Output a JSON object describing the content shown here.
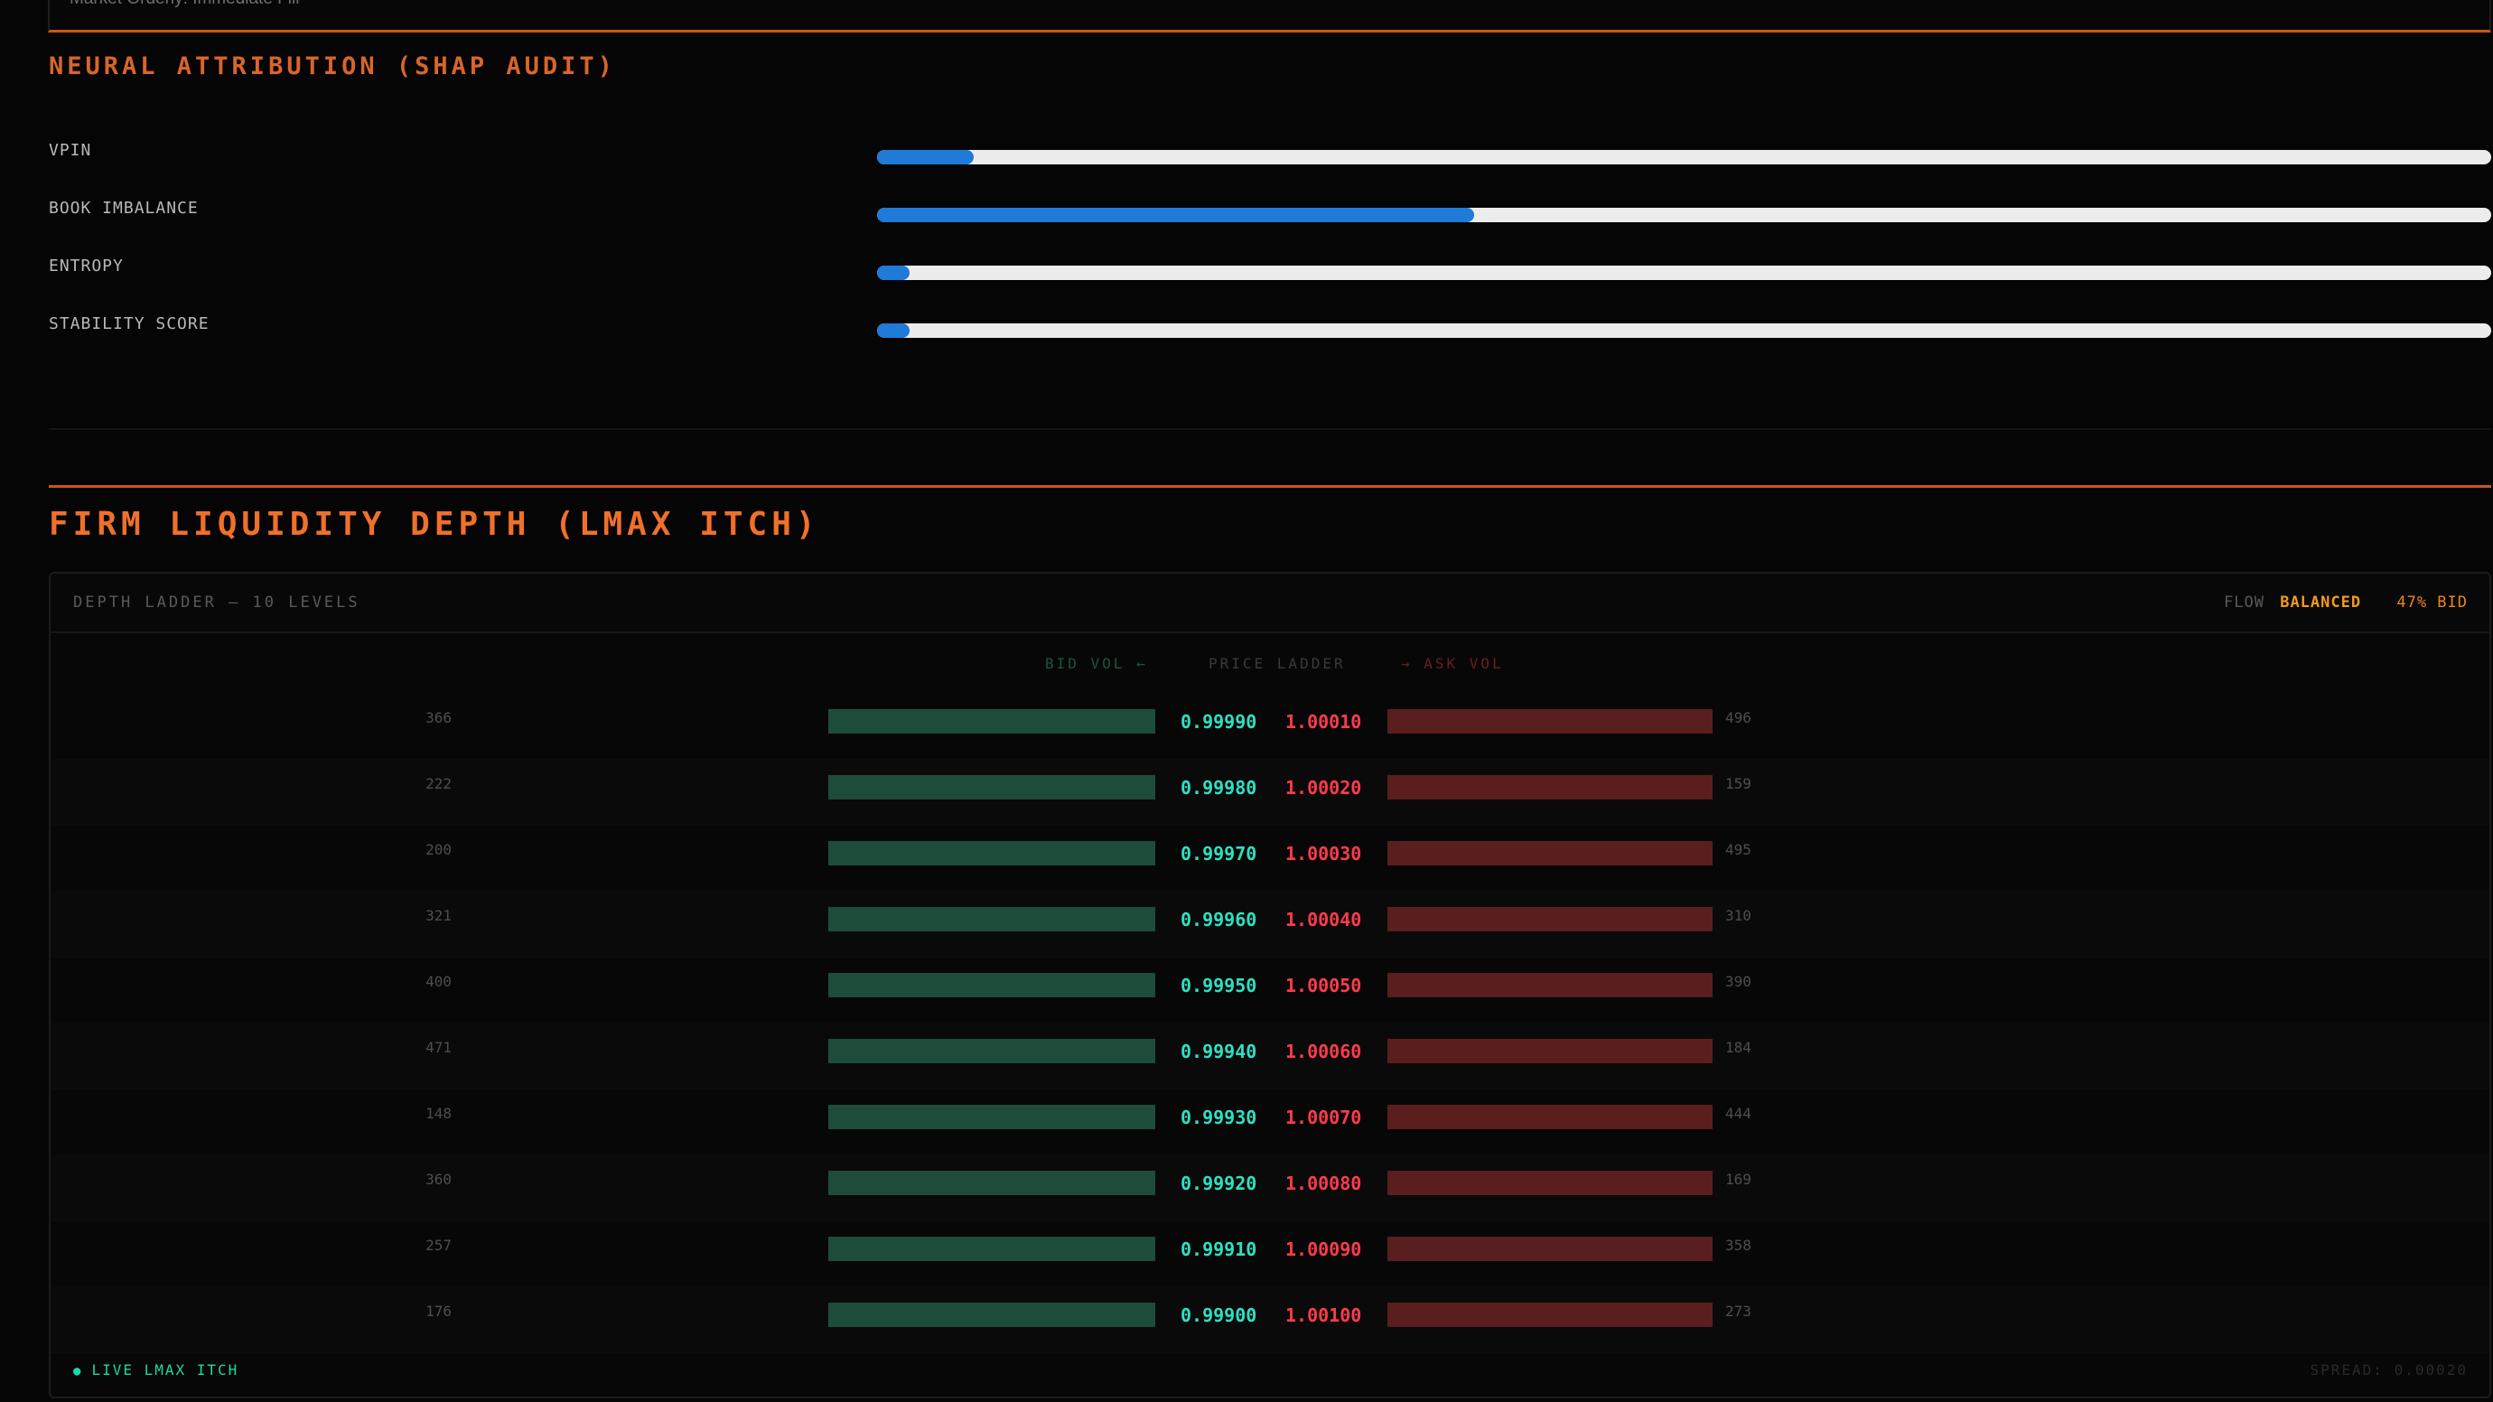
{
  "top_panel": {
    "text": "Market Orderly: Immediate Fill"
  },
  "shap": {
    "title": "NEURAL ATTRIBUTION (SHAP AUDIT)",
    "bar_color": "#1f7ad8",
    "items": [
      {
        "label": "VPIN",
        "value": 0.06
      },
      {
        "label": "BOOK IMBALANCE",
        "value": 0.37
      },
      {
        "label": "ENTROPY",
        "value": 0.02
      },
      {
        "label": "STABILITY SCORE",
        "value": 0.02
      }
    ]
  },
  "depth": {
    "title": "FIRM LIQUIDITY DEPTH (LMAX ITCH)",
    "header_label": "DEPTH LADDER — 10 LEVELS",
    "flow_label": "FLOW",
    "flow_state": "BALANCED",
    "flow_bid": "47% BID",
    "col_bid": "BID VOL ←",
    "col_price": "PRICE LADDER",
    "col_ask": "→ ASK VOL",
    "bid_color": "#2ee0c0",
    "ask_color": "#ff3b4a",
    "rows": [
      {
        "bid_vol": "366",
        "bid_price": "0.99990",
        "ask_price": "1.00010",
        "ask_vol": "496"
      },
      {
        "bid_vol": "222",
        "bid_price": "0.99980",
        "ask_price": "1.00020",
        "ask_vol": "159"
      },
      {
        "bid_vol": "200",
        "bid_price": "0.99970",
        "ask_price": "1.00030",
        "ask_vol": "495"
      },
      {
        "bid_vol": "321",
        "bid_price": "0.99960",
        "ask_price": "1.00040",
        "ask_vol": "310"
      },
      {
        "bid_vol": "400",
        "bid_price": "0.99950",
        "ask_price": "1.00050",
        "ask_vol": "390"
      },
      {
        "bid_vol": "471",
        "bid_price": "0.99940",
        "ask_price": "1.00060",
        "ask_vol": "184"
      },
      {
        "bid_vol": "148",
        "bid_price": "0.99930",
        "ask_price": "1.00070",
        "ask_vol": "444"
      },
      {
        "bid_vol": "360",
        "bid_price": "0.99920",
        "ask_price": "1.00080",
        "ask_vol": "169"
      },
      {
        "bid_vol": "257",
        "bid_price": "0.99910",
        "ask_price": "1.00090",
        "ask_vol": "358"
      },
      {
        "bid_vol": "176",
        "bid_price": "0.99900",
        "ask_price": "1.00100",
        "ask_vol": "273"
      }
    ],
    "live_label": "LIVE LMAX ITCH",
    "spread": "SPREAD: 0.00020"
  }
}
